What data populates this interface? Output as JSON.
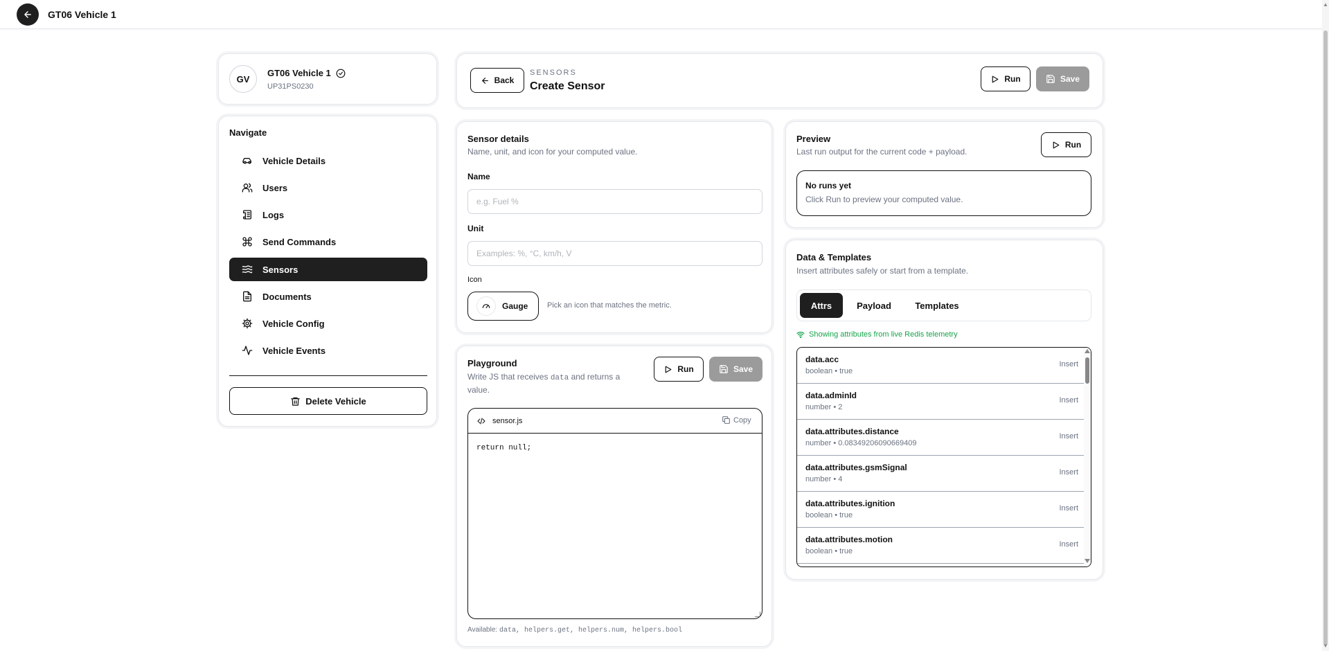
{
  "topbar": {
    "title": "GT06 Vehicle 1"
  },
  "vehicle": {
    "initials": "GV",
    "name": "GT06 Vehicle 1",
    "plate": "UP31PS0230"
  },
  "nav": {
    "heading": "Navigate",
    "items": [
      {
        "label": "Vehicle Details",
        "icon": "car-icon"
      },
      {
        "label": "Users",
        "icon": "users-icon"
      },
      {
        "label": "Logs",
        "icon": "scroll-icon"
      },
      {
        "label": "Send Commands",
        "icon": "command-icon"
      },
      {
        "label": "Sensors",
        "icon": "waves-icon",
        "active": true
      },
      {
        "label": "Documents",
        "icon": "document-icon"
      },
      {
        "label": "Vehicle Config",
        "icon": "gear-icon"
      },
      {
        "label": "Vehicle Events",
        "icon": "activity-icon"
      }
    ],
    "delete_label": "Delete Vehicle"
  },
  "header": {
    "back_label": "Back",
    "eyebrow": "SENSORS",
    "title": "Create Sensor",
    "run_label": "Run",
    "save_label": "Save"
  },
  "details": {
    "title": "Sensor details",
    "subtitle": "Name, unit, and icon for your computed value.",
    "name_label": "Name",
    "name_placeholder": "e.g. Fuel %",
    "unit_label": "Unit",
    "unit_placeholder": "Examples: %, °C, km/h, V",
    "icon_label": "Icon",
    "icon_value": "Gauge",
    "icon_hint": "Pick an icon that matches the metric."
  },
  "playground": {
    "title": "Playground",
    "subtitle_pre": "Write JS that receives ",
    "subtitle_code": "data",
    "subtitle_post": " and returns a",
    "subtitle_line2": "value.",
    "run_label": "Run",
    "save_label": "Save",
    "filename": "sensor.js",
    "copy_label": "Copy",
    "code": "return null;",
    "available_label": "Available:",
    "available_items": "data, helpers.get, helpers.num, helpers.bool"
  },
  "preview": {
    "title": "Preview",
    "subtitle": "Last run output for the current code + payload.",
    "run_label": "Run",
    "empty_title": "No runs yet",
    "empty_text": "Click Run to preview your computed value."
  },
  "templates": {
    "title": "Data & Templates",
    "subtitle": "Insert attributes safely or start from a template.",
    "tabs": [
      "Attrs",
      "Payload",
      "Templates"
    ],
    "live_text": "Showing attributes from live Redis telemetry",
    "live_color": "#16a34a",
    "insert_label": "Insert",
    "attrs": [
      {
        "name": "data.acc",
        "meta": "boolean • true"
      },
      {
        "name": "data.adminId",
        "meta": "number • 2"
      },
      {
        "name": "data.attributes.distance",
        "meta": "number • 0.08349206090669409"
      },
      {
        "name": "data.attributes.gsmSignal",
        "meta": "number • 4"
      },
      {
        "name": "data.attributes.ignition",
        "meta": "boolean • true"
      },
      {
        "name": "data.attributes.motion",
        "meta": "boolean • true"
      }
    ]
  }
}
